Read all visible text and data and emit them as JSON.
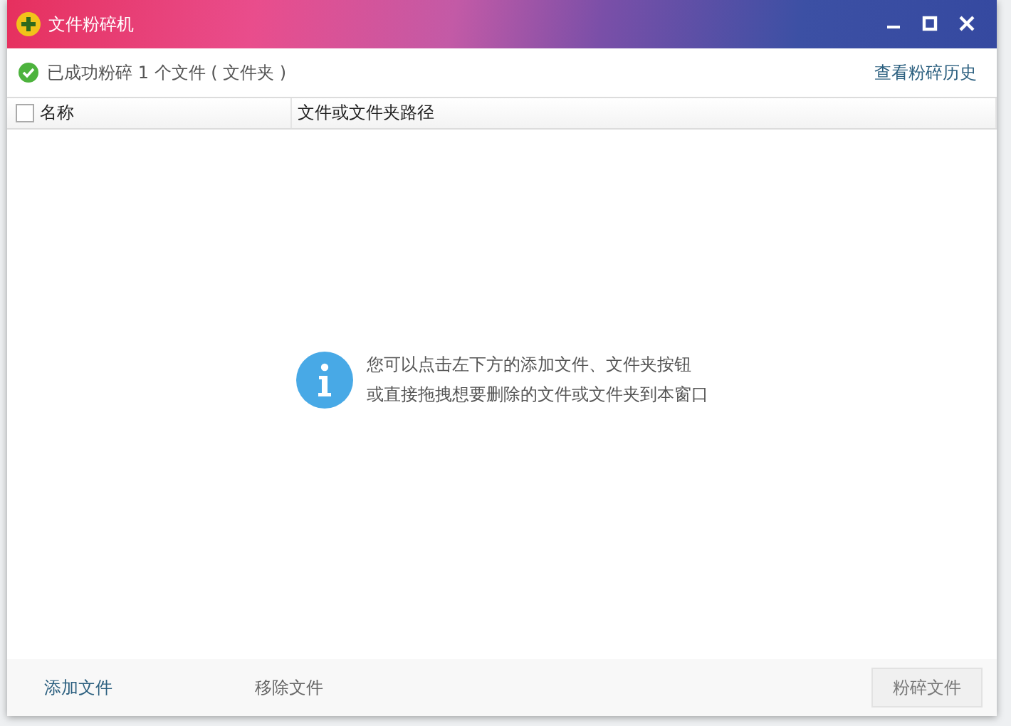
{
  "window": {
    "title": "文件粉碎机"
  },
  "status": {
    "message": "已成功粉碎 1 个文件 ( 文件夹 )",
    "history_link": "查看粉碎历史"
  },
  "table": {
    "select_all_checked": false,
    "columns": [
      "名称",
      "文件或文件夹路径"
    ]
  },
  "hint": {
    "lines": [
      "您可以点击左下方的添加文件、文件夹按钮",
      "或直接拖拽想要删除的文件或文件夹到本窗口"
    ]
  },
  "footer": {
    "buttons": [
      {
        "label": "添加文件",
        "disabled": false,
        "kind": "link"
      },
      {
        "label": "移除文件",
        "disabled": true,
        "kind": "link"
      },
      {
        "label": "粉碎文件",
        "disabled": true,
        "kind": "button"
      }
    ]
  }
}
